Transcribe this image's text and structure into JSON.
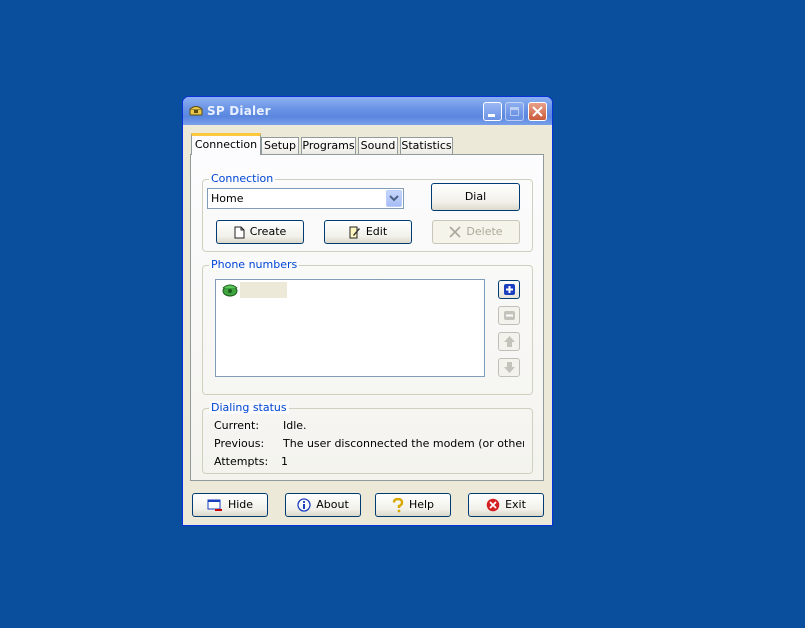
{
  "window": {
    "title": "SP Dialer"
  },
  "tabs": [
    "Connection",
    "Setup",
    "Programs",
    "Sound",
    "Statistics"
  ],
  "connection_group": {
    "label": "Connection",
    "selected": "Home",
    "dial_label": "Dial",
    "create_label": "Create",
    "edit_label": "Edit",
    "delete_label": "Delete"
  },
  "phone_group": {
    "label": "Phone numbers",
    "entries": [
      ""
    ]
  },
  "status_group": {
    "label": "Dialing status",
    "current_label": "Current:",
    "current_value": "Idle.",
    "previous_label": "Previous:",
    "previous_value": "The user disconnected the modem (or other conne",
    "attempts_label": "Attempts:",
    "attempts_value": "1"
  },
  "buttons": {
    "hide": "Hide",
    "about": "About",
    "help": "Help",
    "exit": "Exit"
  },
  "colors": {
    "desktop": "#0A4F9D",
    "group_label": "#0046D5",
    "active_tab_accent": "#FFC83C"
  }
}
